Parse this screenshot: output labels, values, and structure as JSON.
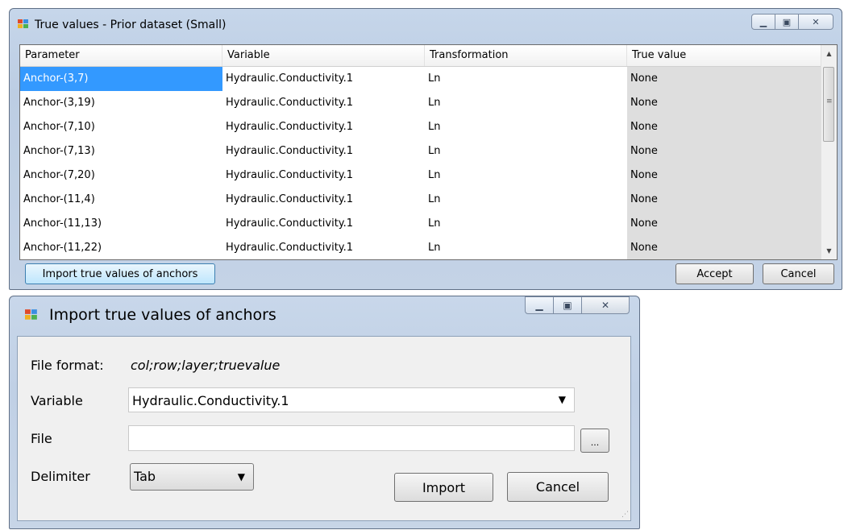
{
  "win1": {
    "title": "True values - Prior dataset (Small)",
    "columns": [
      "Parameter",
      "Variable",
      "Transformation",
      "True value"
    ],
    "rows": [
      [
        "Anchor-(3,7)",
        "Hydraulic.Conductivity.1",
        "Ln",
        "None"
      ],
      [
        "Anchor-(3,19)",
        "Hydraulic.Conductivity.1",
        "Ln",
        "None"
      ],
      [
        "Anchor-(7,10)",
        "Hydraulic.Conductivity.1",
        "Ln",
        "None"
      ],
      [
        "Anchor-(7,13)",
        "Hydraulic.Conductivity.1",
        "Ln",
        "None"
      ],
      [
        "Anchor-(7,20)",
        "Hydraulic.Conductivity.1",
        "Ln",
        "None"
      ],
      [
        "Anchor-(11,4)",
        "Hydraulic.Conductivity.1",
        "Ln",
        "None"
      ],
      [
        "Anchor-(11,13)",
        "Hydraulic.Conductivity.1",
        "Ln",
        "None"
      ],
      [
        "Anchor-(11,22)",
        "Hydraulic.Conductivity.1",
        "Ln",
        "None"
      ]
    ],
    "import_button": "Import  true values of anchors",
    "accept_button": "Accept",
    "cancel_button": "Cancel"
  },
  "win2": {
    "title": "Import true values of anchors",
    "file_format_label": "File format:",
    "file_format_value": "col;row;layer;truevalue",
    "variable_label": "Variable",
    "variable_value": "Hydraulic.Conductivity.1",
    "file_label": "File",
    "file_value": "",
    "browse_button": "...",
    "delimiter_label": "Delimiter",
    "delimiter_value": "Tab",
    "import_button": "Import",
    "cancel_button": "Cancel"
  },
  "caption_buttons": {
    "minimize": "—",
    "maximize": "□",
    "close": "✕"
  }
}
